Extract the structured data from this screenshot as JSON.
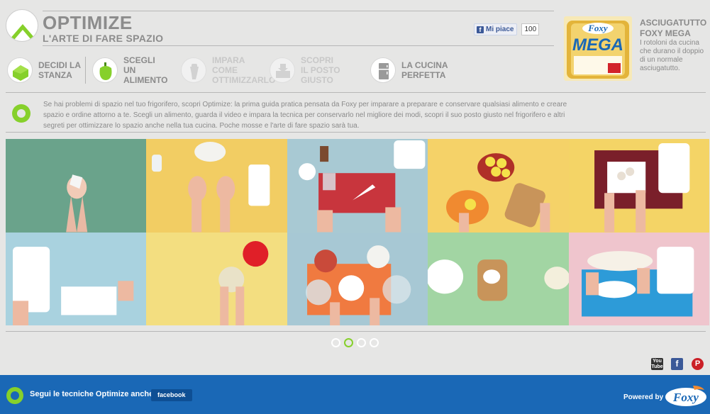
{
  "header": {
    "title": "OPTIMIZE",
    "subtitle": "L'ARTE DI FARE SPAZIO"
  },
  "like": {
    "label": "Mi piace",
    "count": "100"
  },
  "nav": {
    "steps": [
      {
        "line1": "DECIDI LA",
        "line2": "STANZA",
        "icon": "house-icon",
        "state": "done"
      },
      {
        "line1": "SCEGLI",
        "line2": "UN ALIMENTO",
        "icon": "pepper-icon",
        "state": "active"
      },
      {
        "line1": "IMPARA COME",
        "line2": "OTTIMIZZARLO",
        "icon": "hand-icon",
        "state": "disabled"
      },
      {
        "line1": "SCOPRI",
        "line2": "IL POSTO GIUSTO",
        "icon": "drawer-icon",
        "state": "disabled"
      },
      {
        "line1": "LA CUCINA",
        "line2": "PERFETTA",
        "icon": "fridge-icon",
        "state": "enabled"
      }
    ]
  },
  "product": {
    "brand": "Foxy",
    "name": "MEGA",
    "title_line1": "ASCIUGATUTTO",
    "title_line2": "FOXY MEGA",
    "description": "I rotoloni da cucina che durano il doppio di un normale asciugatutto."
  },
  "intro": "Se hai problemi di spazio nel tuo frigorifero, scopri Optimize: la prima guida pratica pensata da Foxy per imparare a preparare e conservare qualsiasi alimento e creare spazio e ordine attorno a te. Scegli un alimento, guarda il video e impara la tecnica per conservarlo nel migliore dei modi, scopri il suo posto giusto nel frigorifero e altri segreti per ottimizzare lo spazio anche nella tua cucina. Poche mosse e l'arte di fare spazio sarà tua.",
  "grid": {
    "colors": [
      "#6aa38b",
      "#f2cd63",
      "#a8c9d3",
      "#f5d268",
      "#f4d466",
      "#a9d2df",
      "#f3de80",
      "#a7c8d4",
      "#a2d5a3",
      "#efc5cd"
    ]
  },
  "pager": {
    "pages": 4,
    "active": 2
  },
  "social": [
    "youtube-icon",
    "facebook-icon",
    "pinterest-icon"
  ],
  "footer": {
    "follow_text": "Segui le tecniche Optimize anche su",
    "facebook_label": "facebook",
    "powered_by": "Powered by",
    "logo_text": "Foxy"
  },
  "colors": {
    "accent": "#86d02b",
    "footer": "#1a68b6",
    "background": "#e6e6e5"
  }
}
